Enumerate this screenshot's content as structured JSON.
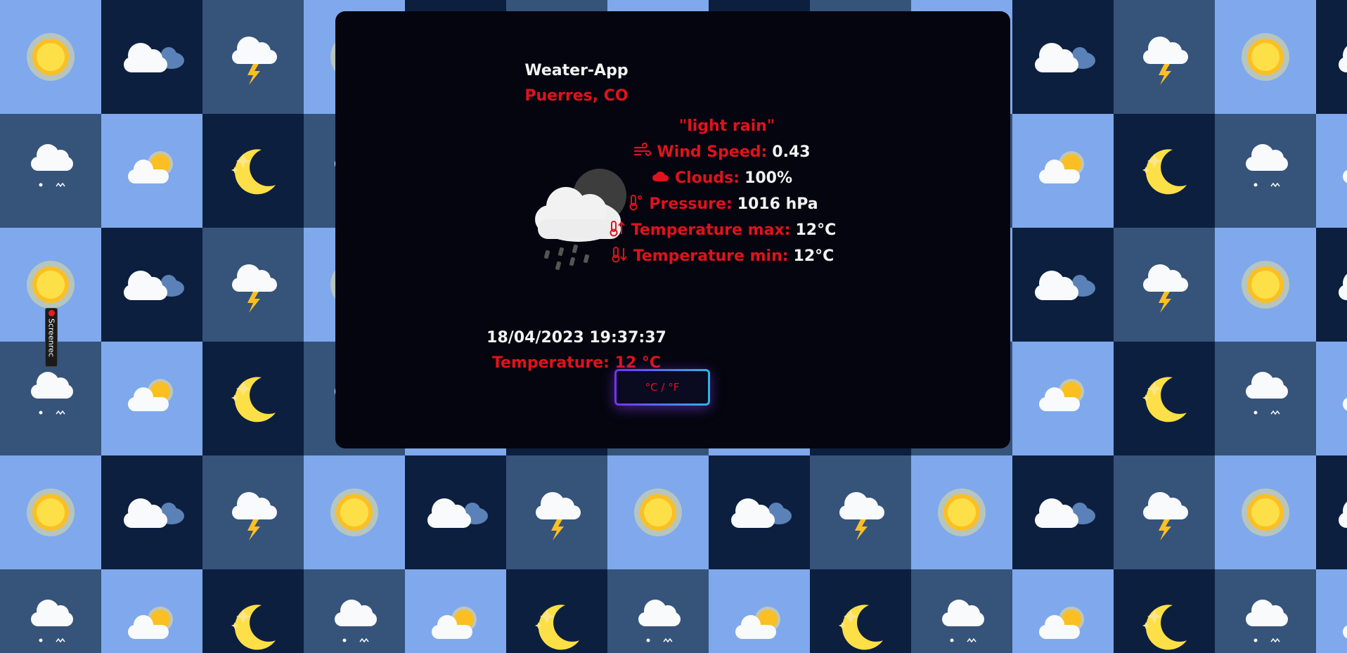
{
  "app": {
    "title": "Weater-App",
    "location": "Puerres, CO"
  },
  "weather": {
    "description": "\"light rain\"",
    "icon": "rain-cloud-moon-icon",
    "wind_speed": {
      "label": "Wind Speed:",
      "value": "0.43",
      "icon": "wind-icon"
    },
    "clouds": {
      "label": "Clouds:",
      "value": "100%",
      "icon": "cloud-icon"
    },
    "pressure": {
      "label": "Pressure:",
      "value": "1016 hPa",
      "icon": "thermometer-icon"
    },
    "temp_max": {
      "label": "Temperature max:",
      "value": "12°C",
      "icon": "thermometer-up-icon"
    },
    "temp_min": {
      "label": "Temperature min:",
      "value": "12°C",
      "icon": "thermometer-down-icon"
    }
  },
  "datetime": "18/04/2023 19:37:37",
  "temperature": "Temperature: 12 °C",
  "toggle_button": {
    "label": "°C / °F"
  },
  "screenrec_badge": {
    "label": "Screenrec"
  },
  "colors": {
    "accent_red": "#e0121d",
    "card_bg": "#05050f",
    "tile_light": "#7fa9ec",
    "tile_navy": "#0d1f3f",
    "tile_slate": "#36537a"
  }
}
